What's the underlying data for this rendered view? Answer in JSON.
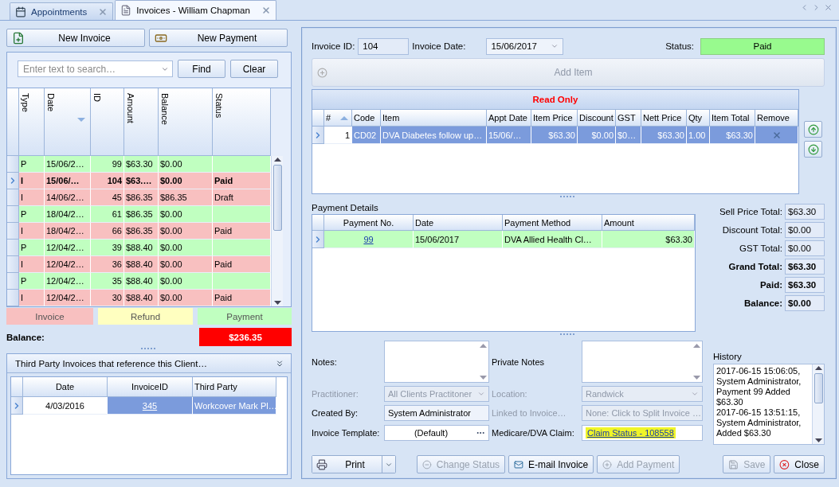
{
  "tabs": [
    {
      "label": "Appointments",
      "selected": false
    },
    {
      "label": "Invoices - William Chapman",
      "selected": true
    }
  ],
  "invoice_list": {
    "buttons": [
      {
        "label": "New Invoice"
      },
      {
        "label": "New Payment"
      }
    ],
    "search": {
      "placeholder": "Enter text to search…"
    },
    "search_buttons": [
      "Find",
      "Clear"
    ],
    "columns": [
      {
        "label": "Type",
        "kind": "text",
        "sorted": false
      },
      {
        "label": "Date",
        "kind": "text",
        "sorted": true,
        "descending": true
      },
      {
        "label": "ID",
        "kind": "number",
        "sorted": false
      },
      {
        "label": "Amount",
        "kind": "text",
        "sorted": false
      },
      {
        "label": "Balance",
        "kind": "text",
        "sorted": false
      },
      {
        "label": "Status",
        "kind": "text",
        "sorted": false
      }
    ],
    "rows": [
      {
        "kind": "payment",
        "selected": false,
        "cells": [
          "P",
          "15/06/2…",
          "99",
          "$63.30",
          "$0.00"
        ]
      },
      {
        "kind": "invoice",
        "selected": true,
        "cells": [
          "I",
          "15/06/…",
          "104",
          "$63.…",
          "$0.00",
          "Paid"
        ]
      },
      {
        "kind": "invoice",
        "selected": false,
        "cells": [
          "I",
          "14/06/2…",
          "45",
          "$86.35",
          "$86.35",
          "Draft"
        ]
      },
      {
        "kind": "payment",
        "selected": false,
        "cells": [
          "P",
          "18/04/2…",
          "61",
          "$86.35",
          "$0.00"
        ]
      },
      {
        "kind": "invoice",
        "selected": false,
        "cells": [
          "I",
          "18/04/2…",
          "66",
          "$86.35",
          "$0.00",
          "Paid"
        ]
      },
      {
        "kind": "payment",
        "selected": false,
        "cells": [
          "P",
          "12/04/2…",
          "39",
          "$88.40",
          "$0.00"
        ]
      },
      {
        "kind": "invoice",
        "selected": false,
        "cells": [
          "I",
          "12/04/2…",
          "36",
          "$88.40",
          "$0.00",
          "Paid"
        ]
      },
      {
        "kind": "payment",
        "selected": false,
        "cells": [
          "P",
          "12/04/2…",
          "35",
          "$88.40",
          "$0.00"
        ]
      },
      {
        "kind": "invoice",
        "selected": false,
        "cells": [
          "I",
          "12/04/2…",
          "30",
          "$88.40",
          "$0.00",
          "Paid"
        ]
      }
    ],
    "legend": [
      {
        "label": "Invoice",
        "color": "#f8c0c0"
      },
      {
        "label": "Refund",
        "color": "#ffffc0"
      },
      {
        "label": "Payment",
        "color": "#c0ffc0"
      }
    ],
    "balance": {
      "label": "Balance:",
      "value": "$236.35"
    }
  },
  "third_party": {
    "title": "Third Party Invoices that reference this Client…",
    "columns": [
      {
        "label": "Date",
        "kind": "center"
      },
      {
        "label": "InvoiceID",
        "kind": "link"
      },
      {
        "label": "Third Party",
        "kind": "text"
      }
    ],
    "rows": [
      {
        "selected": true,
        "cells": [
          "4/03/2016",
          "345",
          "Workcover Mark Pl…"
        ]
      }
    ]
  },
  "invoice": {
    "id_label": "Invoice ID:",
    "id": "104",
    "date_label": "Invoice Date:",
    "date": "15/06/2017",
    "status_label": "Status:",
    "status": "Paid",
    "add_item": {
      "label": "Add Item",
      "disabled": true
    },
    "items": {
      "title": "Read Only",
      "columns": [
        {
          "label": "#",
          "kind": "number",
          "sorted": true,
          "descending": false
        },
        {
          "label": "Code",
          "kind": "text",
          "sorted": false
        },
        {
          "label": "Item",
          "kind": "text",
          "sorted": false
        },
        {
          "label": "Appt Date",
          "kind": "text",
          "sorted": false
        },
        {
          "label": "Item Price",
          "kind": "number",
          "sorted": false
        },
        {
          "label": "Discount",
          "kind": "number",
          "sorted": false
        },
        {
          "label": "GST",
          "kind": "text",
          "sorted": false
        },
        {
          "label": "Nett Price",
          "kind": "number",
          "sorted": false
        },
        {
          "label": "Qty",
          "kind": "text",
          "sorted": false
        },
        {
          "label": "Item Total",
          "kind": "number",
          "sorted": false
        },
        {
          "label": "Remove",
          "kind": "remove",
          "sorted": false
        }
      ],
      "rows": [
        {
          "selected": true,
          "cells": [
            "1",
            "CD02",
            "DVA Diabetes follow up…",
            "15/06/…",
            "$63.30",
            "$0.00",
            "$0…",
            "$63.30",
            "1.00",
            "$63.30"
          ]
        }
      ]
    },
    "payments": {
      "title": "Payment Details",
      "columns": [
        {
          "label": "Payment No.",
          "kind": "link"
        },
        {
          "label": "Date",
          "kind": "text"
        },
        {
          "label": "Payment Method",
          "kind": "text"
        },
        {
          "label": "Amount",
          "kind": "number"
        }
      ],
      "rows": [
        {
          "kind": "payment",
          "selected": true,
          "cells": [
            "99",
            "15/06/2017",
            "DVA Allied Health Cl…",
            "$63.30"
          ]
        }
      ]
    },
    "totals": [
      {
        "label": "Sell Price Total:",
        "value": "$63.30",
        "bold": false
      },
      {
        "label": "Discount Total:",
        "value": "$0.00",
        "bold": false
      },
      {
        "label": "GST Total:",
        "value": "$0.00",
        "bold": false
      },
      {
        "label": "Grand Total:",
        "value": "$63.30",
        "bold": true
      },
      {
        "label": "Paid:",
        "value": "$63.30",
        "bold": true
      },
      {
        "label": "Balance:",
        "value": "$0.00",
        "bold": true
      }
    ],
    "notes_label": "Notes:",
    "private_notes_label": "Private Notes",
    "fields": [
      {
        "label": "Practitioner:",
        "value": "All Clients Practitoner",
        "kind": "dropdown",
        "disabled": true
      },
      {
        "label": "Location:",
        "value": "Randwick",
        "kind": "dropdown",
        "disabled": true
      },
      {
        "label": "Created By:",
        "value": "System Administrator",
        "kind": "readonly",
        "disabled": false
      },
      {
        "label": "Linked to Invoice…",
        "value": "None: Click to Split Invoice …",
        "kind": "readonly",
        "disabled": true
      },
      {
        "label": "Invoice Template:",
        "value": "(Default)",
        "kind": "ellipsis",
        "disabled": false
      },
      {
        "label": "Medicare/DVA Claim:",
        "value": "Claim Status - 108558",
        "kind": "link",
        "disabled": false
      }
    ],
    "history": {
      "label": "History",
      "entries": [
        "2017-06-15 15:06:05, System Administrator, Payment 99 Added $63.30",
        "2017-06-15 13:51:15, System Administrator, Added $63.30"
      ]
    },
    "actions": [
      {
        "label": "Print",
        "kind": "split",
        "disabled": false
      },
      {
        "label": "Change Status",
        "kind": "plain",
        "disabled": true
      },
      {
        "label": "E-mail Invoice",
        "kind": "plain",
        "disabled": false
      },
      {
        "label": "Add Payment",
        "kind": "plain",
        "disabled": true
      },
      {
        "label": "Save",
        "kind": "plain",
        "disabled": true
      },
      {
        "label": "Close",
        "kind": "plain",
        "disabled": false
      }
    ]
  }
}
